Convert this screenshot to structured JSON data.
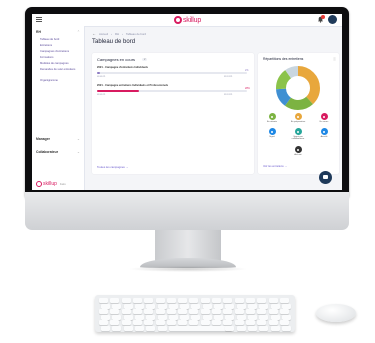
{
  "app": {
    "logo_text": "skillup",
    "brand_color": "#d81b60",
    "accent_color": "#6a5acd",
    "dark_color": "#1f3a5a"
  },
  "header": {
    "menu_icon": "hamburger-icon",
    "notification_icon": "bell-icon",
    "avatar_icon": "user-avatar"
  },
  "sidebar": {
    "sections": [
      {
        "label": "RH",
        "items": [
          "Tableau de bord",
          "Entretiens",
          "Campagnes d'entretiens",
          "Formations",
          "Modèles de campagnes",
          "Demandes de suivi entretiens",
          "Organigramme"
        ]
      },
      {
        "label": "Manager",
        "items": []
      },
      {
        "label": "Collaborateur",
        "items": []
      }
    ],
    "footer_logo": "skillup",
    "footer_sub": "Faire"
  },
  "main": {
    "breadcrumb": [
      "Accueil",
      "RH",
      "Tableau de bord"
    ],
    "title": "Tableau de bord",
    "campaigns_card": {
      "title": "Campagnes en cours",
      "count": "2",
      "campaigns": [
        {
          "name": "2021 - Campagne d'entretiens Individuels",
          "progress": 0.02,
          "percent": "2%",
          "color": "#8e7cc3",
          "start": "01/01/21",
          "end": "31/12/21"
        },
        {
          "name": "2021 - Campagne entretiens Individuels et Professionnels",
          "progress": 0.28,
          "percent": "28%",
          "color": "#d81b60",
          "start": "01/01/21",
          "end": "31/12/21"
        }
      ],
      "link": "Toutes les campagnes →"
    },
    "donut_card": {
      "title": "Répartitions des entretiens",
      "link": "Voir les entretiens →",
      "chart_data": {
        "type": "pie",
        "values": [
          38,
          22,
          14,
          16,
          10
        ],
        "colors": [
          "#e8a73c",
          "#7cb342",
          "#3f8fd2",
          "#8bc34a",
          "#c9d6df"
        ]
      },
      "legend": [
        {
          "label": "En attente",
          "color": "#7cb342"
        },
        {
          "label": "En préparation",
          "color": "#e8a73c"
        },
        {
          "label": "En cours",
          "color": "#d81b60"
        },
        {
          "label": "Signé",
          "color": "#1e88e5"
        },
        {
          "label": "Signé par collaborateur",
          "color": "#26a69a"
        },
        {
          "label": "Annulé",
          "color": "#1e88e5"
        },
        {
          "label": "Archivé",
          "color": "#333333"
        }
      ]
    }
  }
}
